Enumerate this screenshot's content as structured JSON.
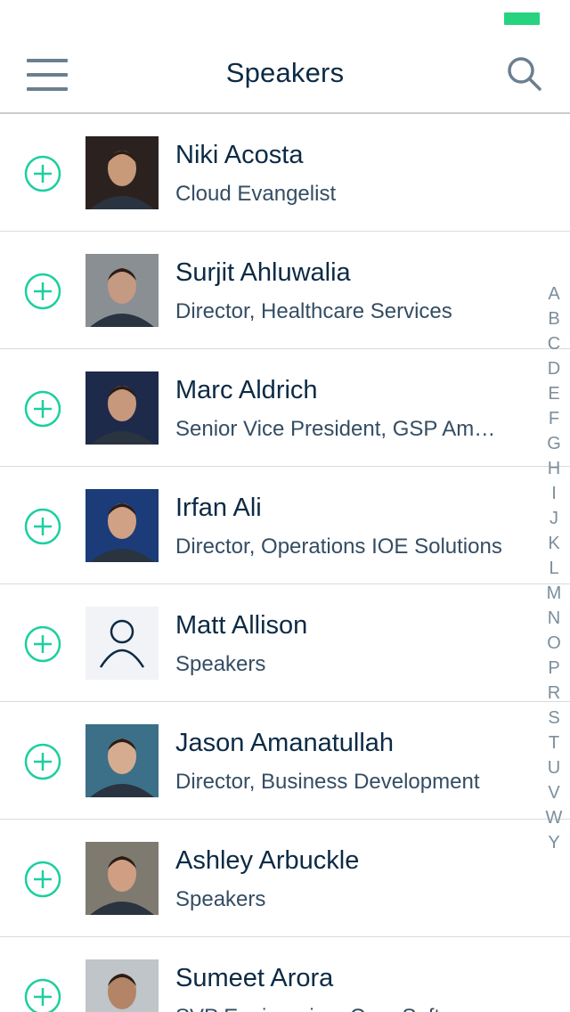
{
  "status": {
    "battery_color": "#27d37e"
  },
  "nav": {
    "title": "Speakers",
    "menu_icon": "hamburger-menu-icon",
    "search_icon": "search-icon"
  },
  "colors": {
    "accent": "#1ccfa0",
    "text": "#0b2a45",
    "subtext": "#344d63",
    "index": "#7c8e9c"
  },
  "speakers": [
    {
      "name": "Niki Acosta",
      "title": "Cloud Evangelist",
      "photo": "photo"
    },
    {
      "name": "Surjit Ahluwalia",
      "title": "Director, Healthcare Services",
      "photo": "photo"
    },
    {
      "name": "Marc Aldrich",
      "title": "Senior Vice President, GSP Am…",
      "photo": "photo"
    },
    {
      "name": "Irfan Ali",
      "title": "Director, Operations IOE Solutions",
      "photo": "photo"
    },
    {
      "name": "Matt Allison",
      "title": "Speakers",
      "photo": "placeholder-person-icon"
    },
    {
      "name": "Jason Amanatullah",
      "title": "Director, Business Development",
      "photo": "photo"
    },
    {
      "name": "Ashley Arbuckle",
      "title": "Speakers",
      "photo": "photo"
    },
    {
      "name": "Sumeet Arora",
      "title": "SVP Engineering, Core Soft...",
      "photo": "photo"
    }
  ],
  "index_letters": [
    "A",
    "B",
    "C",
    "D",
    "E",
    "F",
    "G",
    "H",
    "I",
    "J",
    "K",
    "L",
    "M",
    "N",
    "O",
    "P",
    "R",
    "S",
    "T",
    "U",
    "V",
    "W",
    "Y"
  ]
}
